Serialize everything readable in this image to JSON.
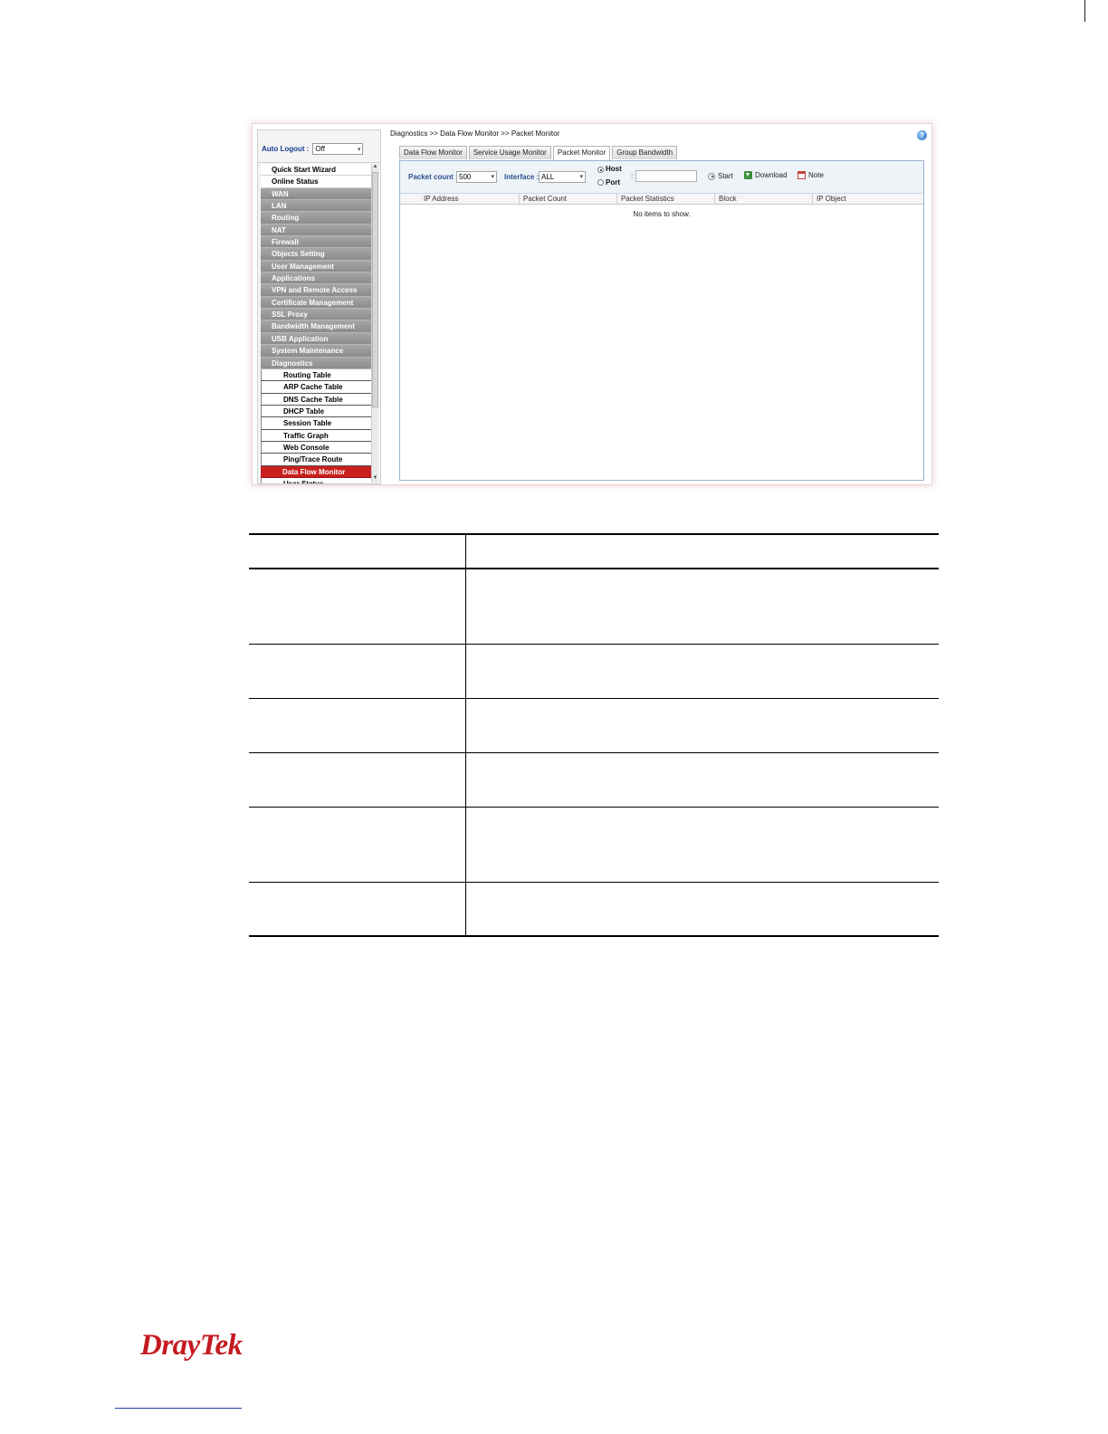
{
  "sidebar": {
    "autologout_label": "Auto Logout :",
    "autologout_value": "Off",
    "items": [
      {
        "label": "Quick Start Wizard",
        "style": "white"
      },
      {
        "label": "Online Status",
        "style": "white"
      },
      {
        "label": "WAN",
        "style": "gray"
      },
      {
        "label": "LAN",
        "style": "gray"
      },
      {
        "label": "Routing",
        "style": "gray"
      },
      {
        "label": "NAT",
        "style": "gray"
      },
      {
        "label": "Firewall",
        "style": "gray"
      },
      {
        "label": "Objects Setting",
        "style": "gray"
      },
      {
        "label": "User Management",
        "style": "gray"
      },
      {
        "label": "Applications",
        "style": "gray"
      },
      {
        "label": "VPN and Remote Access",
        "style": "gray"
      },
      {
        "label": "Certificate Management",
        "style": "gray"
      },
      {
        "label": "SSL Proxy",
        "style": "gray"
      },
      {
        "label": "Bandwidth Management",
        "style": "gray"
      },
      {
        "label": "USB Application",
        "style": "gray"
      },
      {
        "label": "System Maintenance",
        "style": "gray"
      },
      {
        "label": "Diagnostics",
        "style": "gray"
      },
      {
        "label": "Routing Table",
        "style": "sub"
      },
      {
        "label": "ARP Cache Table",
        "style": "sub"
      },
      {
        "label": "DNS Cache Table",
        "style": "sub"
      },
      {
        "label": "DHCP Table",
        "style": "sub"
      },
      {
        "label": "Session Table",
        "style": "sub"
      },
      {
        "label": "Traffic Graph",
        "style": "sub"
      },
      {
        "label": "Web Console",
        "style": "sub"
      },
      {
        "label": "Ping/Trace Route",
        "style": "sub"
      },
      {
        "label": "Data Flow Monitor",
        "style": "active"
      },
      {
        "label": "User Status",
        "style": "sub"
      }
    ]
  },
  "breadcrumb": "Diagnostics >> Data Flow Monitor >> Packet Monitor",
  "tabs": [
    "Data Flow Monitor",
    "Service Usage Monitor",
    "Packet Monitor",
    "Group Bandwidth"
  ],
  "active_tab": "Packet Monitor",
  "toolbar": {
    "packet_count_label": "Packet count :",
    "packet_count_value": "500",
    "interface_label": "Interface :",
    "interface_value": "ALL",
    "radio_host": "Host",
    "radio_port": "Port",
    "colon": ":",
    "start_label": "Start",
    "download_label": "Download",
    "note_label": "Note"
  },
  "table": {
    "columns": [
      "IP Address",
      "Packet Count",
      "Packet Statistics",
      "Block",
      "IP Object"
    ],
    "empty_text": "No items to show."
  },
  "footer": {
    "logo_text": "DrayTek"
  },
  "colors": {
    "active_menu": "#c8201e",
    "logo": "#c41a20",
    "label_blue": "#2b4f8a"
  }
}
